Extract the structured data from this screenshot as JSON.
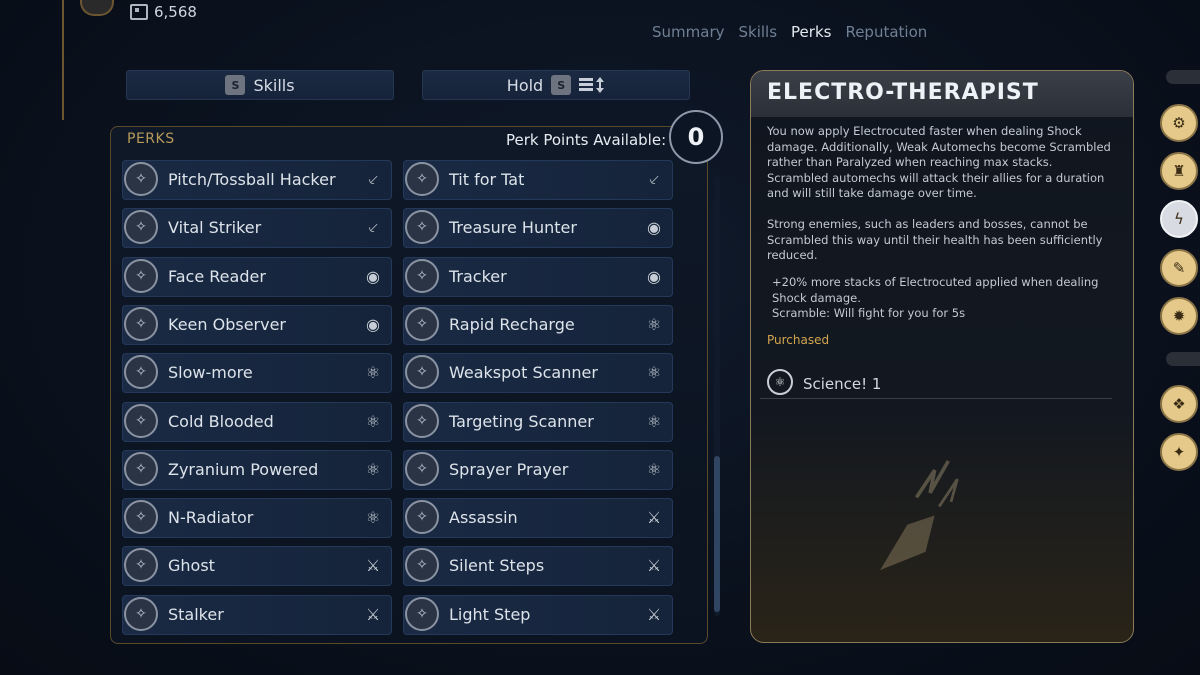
{
  "currency": {
    "amount": "6,568",
    "icon": "currency-icon"
  },
  "tabs": [
    "Summary",
    "Skills",
    "Perks",
    "Reputation"
  ],
  "active_tab": "Perks",
  "top_buttons": {
    "skills": {
      "key": "S",
      "label": "Skills"
    },
    "hold": {
      "label": "Hold",
      "key": "S",
      "icon": "sort-icon"
    }
  },
  "perks_header": "PERKS",
  "perk_points_label": "Perk Points Available:",
  "perk_points": "0",
  "perks_left": [
    {
      "name": "Pitch/Tossball Hacker",
      "icon": "hack-icon",
      "category": "scythe-icon"
    },
    {
      "name": "Vital Striker",
      "icon": "strike-icon",
      "category": "scythe-icon"
    },
    {
      "name": "Face Reader",
      "icon": "face-icon",
      "category": "eye-icon"
    },
    {
      "name": "Keen Observer",
      "icon": "compass-icon",
      "category": "eye-icon"
    },
    {
      "name": "Slow-more",
      "icon": "slow-icon",
      "category": "atom-icon"
    },
    {
      "name": "Cold Blooded",
      "icon": "cold-icon",
      "category": "atom-icon"
    },
    {
      "name": "Zyranium Powered",
      "icon": "zyranium-icon",
      "category": "atom-icon"
    },
    {
      "name": "N-Radiator",
      "icon": "radiator-icon",
      "category": "atom-icon"
    },
    {
      "name": "Ghost",
      "icon": "ghost-icon",
      "category": "sneak-icon"
    },
    {
      "name": "Stalker",
      "icon": "stalker-icon",
      "category": "sneak-icon"
    }
  ],
  "perks_right": [
    {
      "name": "Tit for Tat",
      "icon": "tit-icon",
      "category": "scythe-icon"
    },
    {
      "name": "Treasure Hunter",
      "icon": "chest-icon",
      "category": "eye-icon"
    },
    {
      "name": "Tracker",
      "icon": "tracker-icon",
      "category": "eye-icon"
    },
    {
      "name": "Rapid Recharge",
      "icon": "recharge-icon",
      "category": "atom-icon"
    },
    {
      "name": "Weakspot Scanner",
      "icon": "scanner-icon",
      "category": "atom-icon"
    },
    {
      "name": "Targeting Scanner",
      "icon": "target-icon",
      "category": "atom-icon"
    },
    {
      "name": "Sprayer Prayer",
      "icon": "sprayer-icon",
      "category": "atom-icon"
    },
    {
      "name": "Assassin",
      "icon": "assassin-icon",
      "category": "sneak-icon"
    },
    {
      "name": "Silent Steps",
      "icon": "steps-icon",
      "category": "sneak-icon"
    },
    {
      "name": "Light Step",
      "icon": "lightstep-icon",
      "category": "sneak-icon"
    }
  ],
  "detail": {
    "title": "ELECTRO-THERAPIST",
    "paragraph1": "You now apply Electrocuted faster when dealing Shock damage. Additionally, Weak Automechs become Scrambled rather than Paralyzed when reaching max stacks. Scrambled automechs will attack their allies for a duration and will still take damage over time.",
    "paragraph2": "Strong enemies, such as leaders and bosses, cannot be Scrambled this way until their health has been sufficiently reduced.",
    "bullets": "+20% more stacks of Electrocuted applied when dealing Shock damage.\nScramble: Will fight for you for 5s",
    "status": "Purchased",
    "requirement": "Science! 1"
  },
  "colors": {
    "gold": "#d2a64f",
    "panel": "#1a2a44",
    "rail_gold": "#e5c98a"
  }
}
